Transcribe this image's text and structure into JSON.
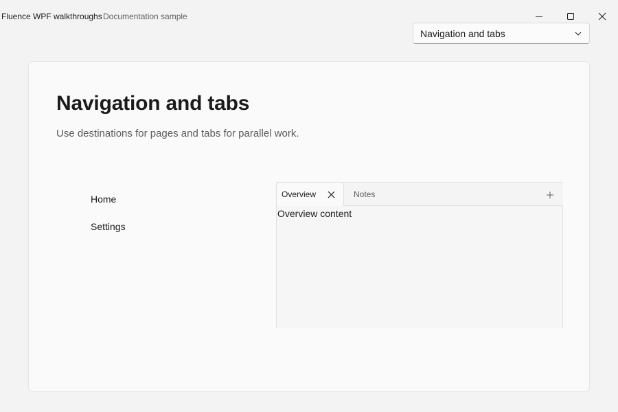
{
  "window": {
    "title": "Fluence WPF walkthroughs",
    "subtitle": "Documentation sample",
    "controls": [
      "minimize-icon",
      "maximize-icon",
      "close-icon"
    ]
  },
  "selector": {
    "value": "Navigation and tabs",
    "icon": "chevron-down-icon"
  },
  "page": {
    "title": "Navigation and tabs",
    "description": "Use destinations for pages and tabs for parallel work."
  },
  "navigation": {
    "items": [
      {
        "label": "Home"
      },
      {
        "label": "Settings"
      }
    ]
  },
  "tabs": {
    "items": [
      {
        "label": "Overview",
        "selected": true,
        "closable": true
      },
      {
        "label": "Notes",
        "selected": false,
        "closable": false
      }
    ],
    "add_icon": "plus-icon",
    "content": "Overview content"
  }
}
